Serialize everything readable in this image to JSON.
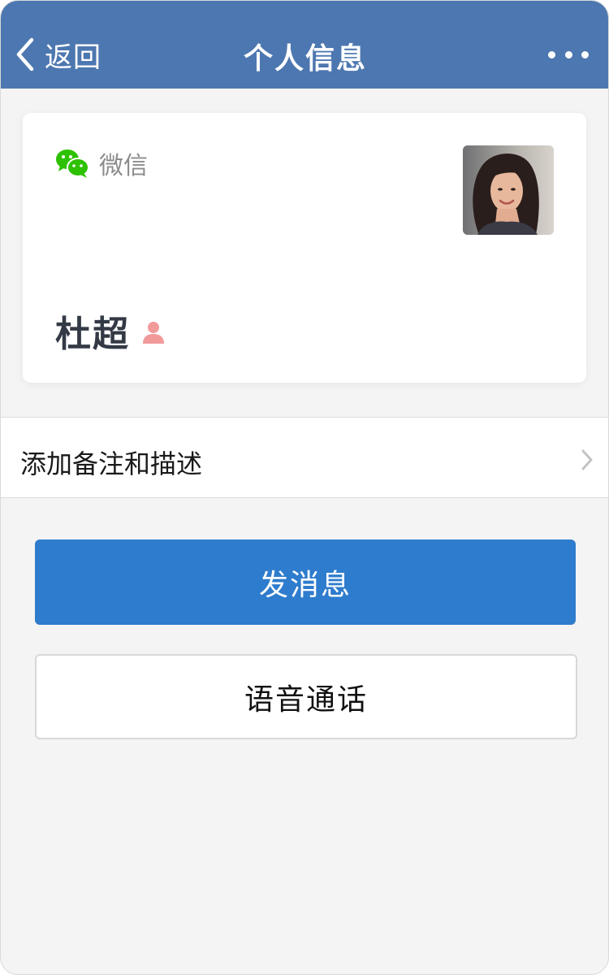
{
  "header": {
    "back_label": "返回",
    "title": "个人信息",
    "more_icon": "more-dots-icon",
    "background_color": "#4d77b0"
  },
  "profile": {
    "source_label": "微信",
    "source_icon": "wechat-icon",
    "name": "杜超",
    "gender_icon": "person-icon",
    "gender_icon_color": "#f29a9a",
    "avatar": "avatar-photo"
  },
  "remark_row": {
    "label": "添加备注和描述",
    "chevron_icon": "chevron-right-icon"
  },
  "actions": {
    "send_message_label": "发消息",
    "send_message_color": "#2e7ccd",
    "voice_call_label": "语音通话"
  }
}
